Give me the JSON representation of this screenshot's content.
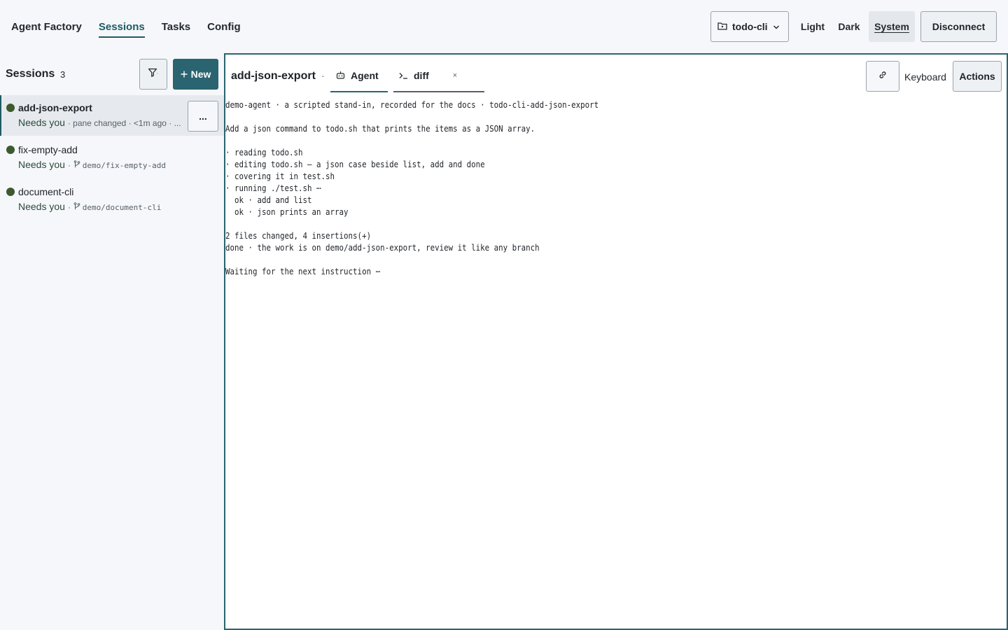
{
  "nav": {
    "items": [
      "Agent Factory",
      "Sessions",
      "Tasks",
      "Config"
    ],
    "active": "Sessions"
  },
  "header": {
    "project": "todo-cli",
    "themes": [
      "Light",
      "Dark",
      "System"
    ],
    "active_theme": "System",
    "disconnect_label": "Disconnect"
  },
  "sidebar": {
    "title": "Sessions",
    "count": "3",
    "new_label": "New",
    "more_label": "...",
    "sessions": [
      {
        "name": "add-json-export",
        "status": "Needs you",
        "detail": "· pane changed · <1m ago · ..."
      },
      {
        "name": "fix-empty-add",
        "status": "Needs you",
        "branch": "demo/fix-empty-add"
      },
      {
        "name": "document-cli",
        "status": "Needs you",
        "branch": "demo/document-cli"
      }
    ]
  },
  "main": {
    "title": "add-json-export",
    "separator": "·",
    "tabs": [
      {
        "label": "Agent"
      },
      {
        "label": "diff",
        "close": "×"
      }
    ],
    "keyboard_label": "Keyboard",
    "actions_label": "Actions",
    "terminal_lines": [
      "demo-agent · a scripted stand-in, recorded for the docs · todo-cli-add-json-export",
      "",
      "Add a json command to todo.sh that prints the items as a JSON array.",
      "",
      "· reading todo.sh",
      "· editing todo.sh — a json case beside list, add and done",
      "· covering it in test.sh",
      "· running ./test.sh ⋯",
      "  ok · add and list",
      "  ok · json prints an array",
      "",
      "2 files changed, 4 insertions(+)",
      "done · the work is on demo/add-json-export, review it like any branch",
      "",
      "Waiting for the next instruction ⋯"
    ]
  },
  "colors": {
    "accent": "#2a6470",
    "status_dot": "#3c5a2e",
    "background": "#f5f7fa"
  }
}
